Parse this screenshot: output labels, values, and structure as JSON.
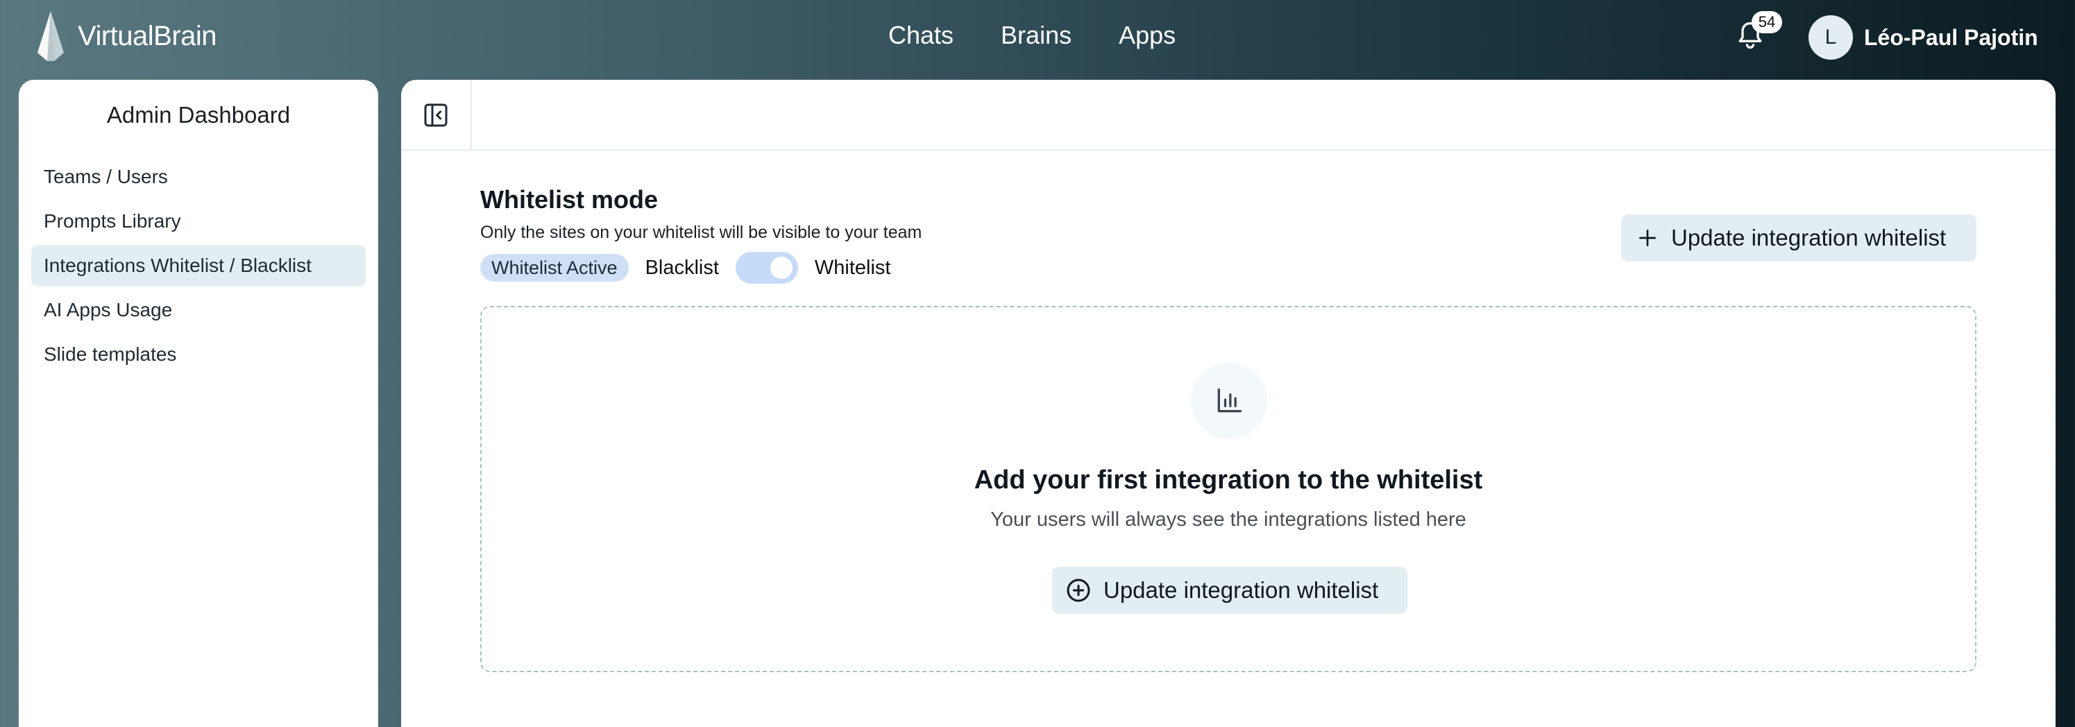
{
  "app": {
    "name": "VirtualBrain"
  },
  "nav": {
    "items": [
      "Chats",
      "Brains",
      "Apps"
    ]
  },
  "notifications": {
    "count": "54"
  },
  "user": {
    "initial": "L",
    "name": "Léo-Paul Pajotin"
  },
  "sidebar": {
    "title": "Admin Dashboard",
    "items": [
      {
        "label": "Teams / Users",
        "active": false
      },
      {
        "label": "Prompts Library",
        "active": false
      },
      {
        "label": "Integrations Whitelist / Blacklist",
        "active": true
      },
      {
        "label": "AI Apps Usage",
        "active": false
      },
      {
        "label": "Slide templates",
        "active": false
      }
    ]
  },
  "whitelist": {
    "title": "Whitelist mode",
    "subtitle": "Only the sites on your whitelist will be visible to your team",
    "status_pill": "Whitelist Active",
    "left_label": "Blacklist",
    "right_label": "Whitelist",
    "toggle_on": true,
    "update_button": "Update integration whitelist"
  },
  "empty_state": {
    "title": "Add your first integration to the whitelist",
    "subtitle": "Your users will always see the integrations listed here",
    "button": "Update integration whitelist"
  },
  "colors": {
    "accent_light": "#e3eef3",
    "pill": "#cfe0f6",
    "toggle": "#c6dbf7"
  }
}
